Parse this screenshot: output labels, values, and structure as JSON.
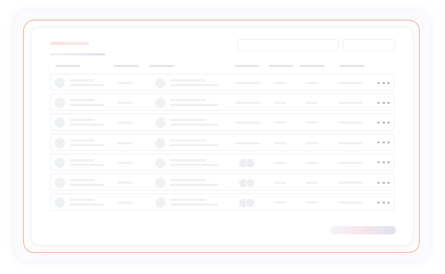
{
  "header": {
    "search": {
      "value": "",
      "placeholder": ""
    },
    "filter_label": ""
  },
  "table": {
    "columns": [
      "",
      "",
      "",
      "",
      "",
      "",
      ""
    ],
    "rows": [
      {
        "stacked_avatars": false
      },
      {
        "stacked_avatars": false
      },
      {
        "stacked_avatars": false
      },
      {
        "stacked_avatars": false
      },
      {
        "stacked_avatars": true
      },
      {
        "stacked_avatars": true
      },
      {
        "stacked_avatars": true
      }
    ]
  },
  "icons": {
    "row_menu": "more-horizontal-icon"
  },
  "colors": {
    "frame_border": "#f3a78a",
    "placeholder": "#eceef2",
    "dots": "#a9adb6"
  }
}
